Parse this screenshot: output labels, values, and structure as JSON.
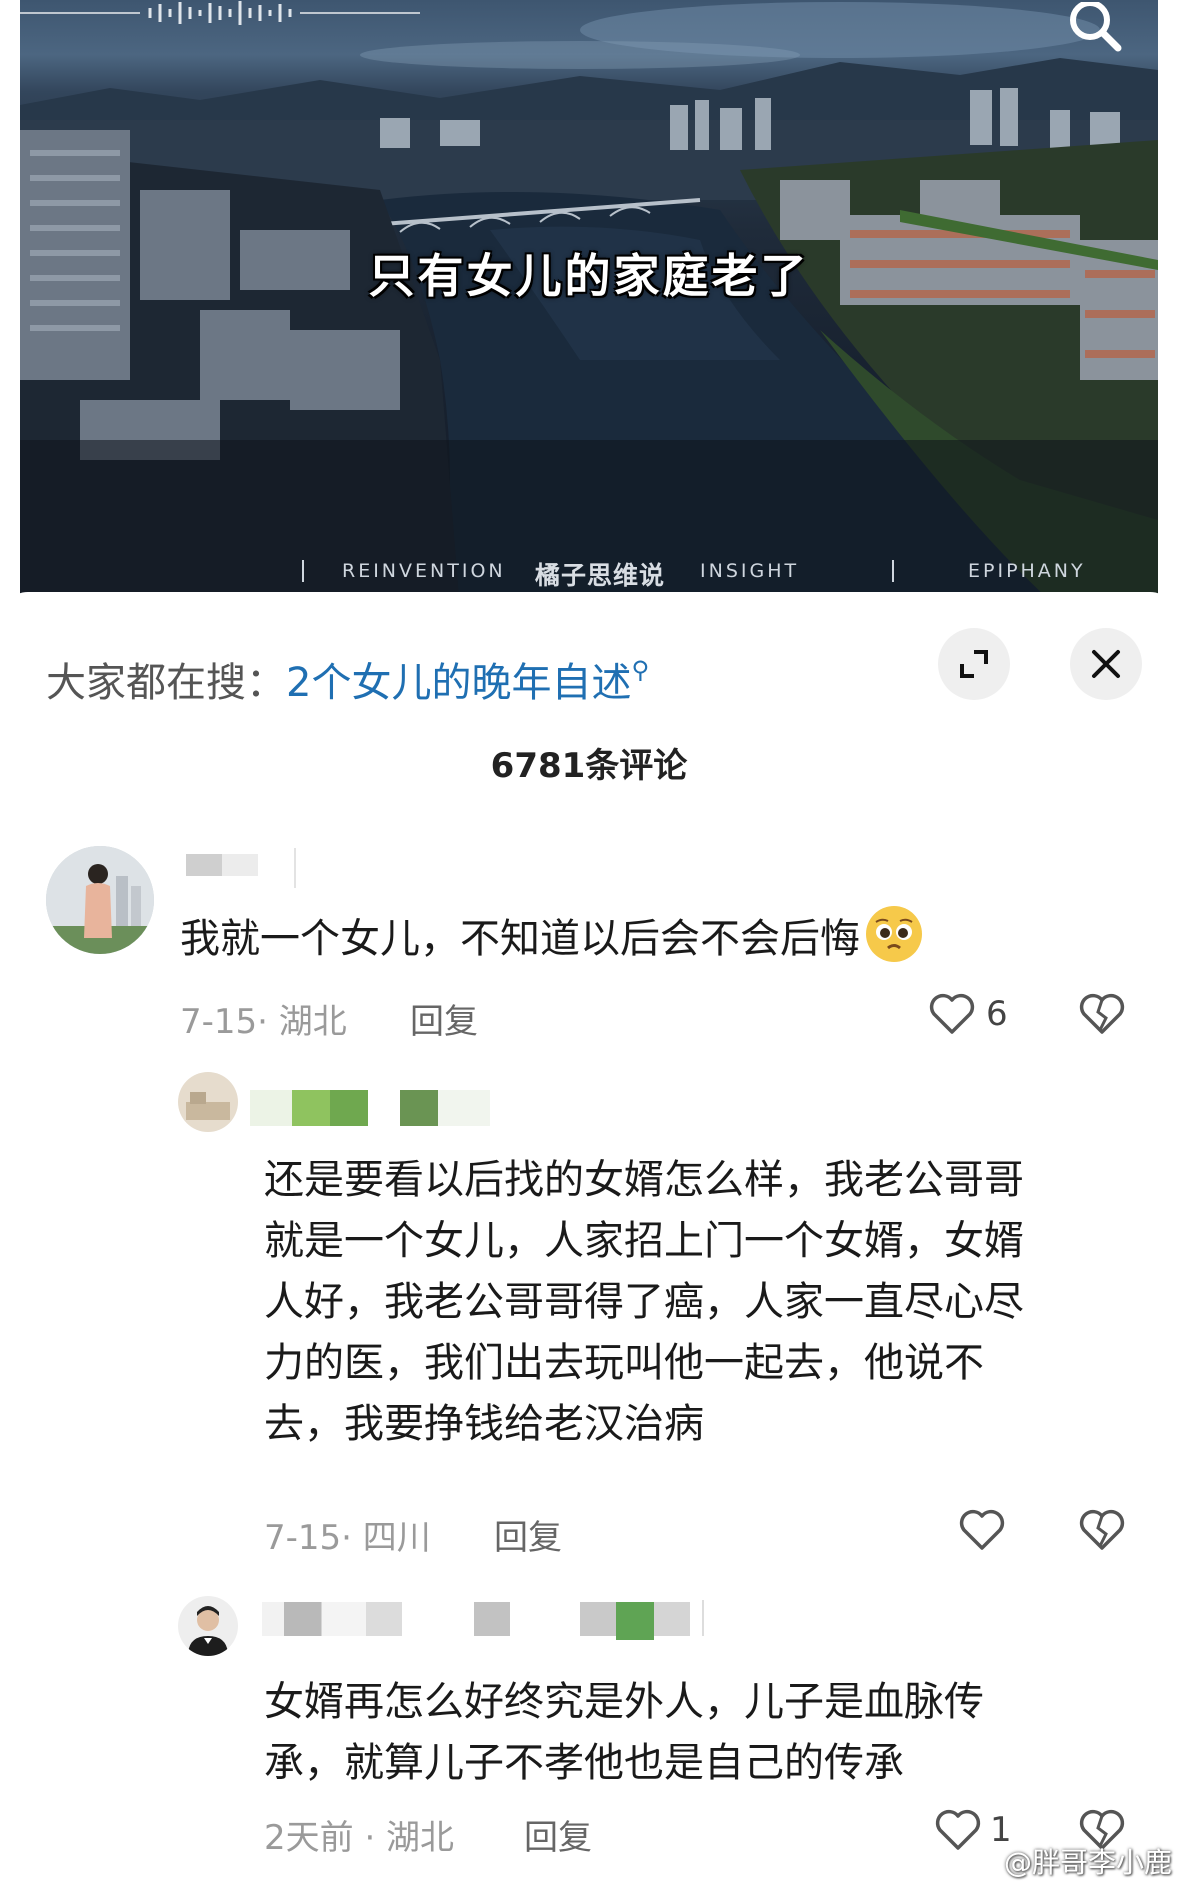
{
  "video": {
    "caption": "只有女儿的家庭老了",
    "brand_left": "REINVENTION",
    "brand_center": "橘子思维说",
    "brand_insight": "INSIGHT",
    "brand_right": "EPIPHANY",
    "search_icon": "search-icon"
  },
  "search_bar": {
    "prefix": "大家都在搜：",
    "query": "2个女儿的晚年自述",
    "expand_icon": "expand-icon",
    "close_icon": "close-icon"
  },
  "comments_count": "6781条评论",
  "comments": [
    {
      "text": "我就一个女儿，不知道以后会不会后悔",
      "emoji": "pleading-face-emoji",
      "meta": "7-15· 湖北",
      "reply": "回复",
      "likes": "6"
    },
    {
      "lines": [
        "还是要看以后找的女婿怎么样，我老公哥哥",
        "就是一个女儿，人家招上门一个女婿，女婿",
        "人好，我老公哥哥得了癌，人家一直尽心尽",
        "力的医，我们出去玩叫他一起去，他说不",
        "去，我要挣钱给老汉治病"
      ],
      "meta": "7-15· 四川",
      "reply": "回复",
      "likes": ""
    },
    {
      "lines": [
        "女婿再怎么好终究是外人，儿子是血脉传",
        "承，就算儿子不孝他也是自己的传承"
      ],
      "meta": "2天前 · 湖北",
      "reply": "回复",
      "likes": "1"
    }
  ],
  "watermark": "@胖哥李小鹿",
  "colors": {
    "link_blue": "#1f6fb2",
    "meta_gray": "#9a9a9a",
    "blur_green": "#6fa84f"
  }
}
